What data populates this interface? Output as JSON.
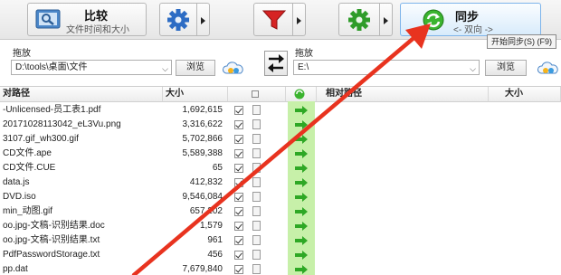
{
  "toolbar": {
    "compare_title": "比较",
    "compare_subtitle": "文件时间和大小",
    "sync_title": "同步",
    "sync_subtitle": "<- 双向 ->",
    "sync_tooltip": "开始同步(S) (F9)"
  },
  "left_panel": {
    "label": "拖放",
    "path": "D:\\tools\\桌面\\文件",
    "browse": "浏览"
  },
  "right_panel": {
    "label": "拖放",
    "path": "E:\\",
    "browse": "浏览"
  },
  "left_grid": {
    "col_path": "对路径",
    "col_size": "大小",
    "rows": [
      {
        "name": "-Unlicensed-员工表1.pdf",
        "size": "1,692,615"
      },
      {
        "name": "20171028113042_eL3Vu.png",
        "size": "3,316,622"
      },
      {
        "name": "3107.gif_wh300.gif",
        "size": "5,702,866"
      },
      {
        "name": "CD文件.ape",
        "size": "5,589,388"
      },
      {
        "name": "CD文件.CUE",
        "size": "65"
      },
      {
        "name": "data.js",
        "size": "412,832"
      },
      {
        "name": "DVD.iso",
        "size": "9,546,084"
      },
      {
        "name": "min_动图.gif",
        "size": "657,202"
      },
      {
        "name": "oo.jpg-文稿-识别结果.doc",
        "size": "1,579"
      },
      {
        "name": "oo.jpg-文稿-识别结果.txt",
        "size": "961"
      },
      {
        "name": "PdfPasswordStorage.txt",
        "size": "456"
      },
      {
        "name": "pp.dat",
        "size": "7,679,840"
      }
    ]
  },
  "right_grid": {
    "col_path": "相对路径",
    "col_size": "大小"
  },
  "colors": {
    "accent": "#e8331f",
    "sync_column": "#c7f0a9",
    "sync_icon": "#2ea825"
  },
  "icons": [
    "compare-icon",
    "gear-icon",
    "filter-icon",
    "sync-icon",
    "swap-icon",
    "cloud-icon",
    "document-icon",
    "green-arrow-icon"
  ]
}
